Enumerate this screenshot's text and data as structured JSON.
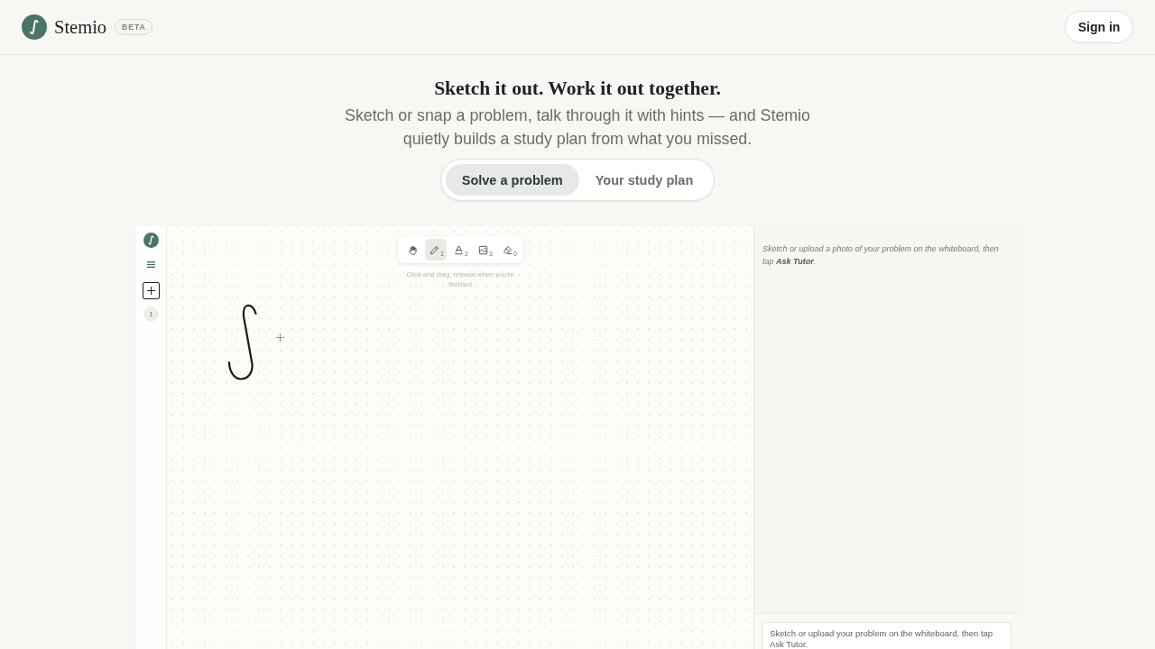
{
  "header": {
    "brand": "Stemio",
    "badge": "BETA",
    "sign_in": "Sign in"
  },
  "hero": {
    "title": "Sketch it out. Work it out together.",
    "subtitle": "Sketch or snap a problem, talk through it with hints — and Stemio quietly builds a study plan from what you missed."
  },
  "mode_tabs": [
    {
      "label": "Solve a problem",
      "selected": true
    },
    {
      "label": "Your study plan",
      "selected": false
    }
  ],
  "workspace": {
    "rail": {
      "page_number": "1"
    },
    "toolbar": {
      "tools": [
        {
          "kind": "hand",
          "selected": false
        },
        {
          "kind": "pencil",
          "selected": true,
          "shortcut": "1"
        },
        {
          "kind": "text",
          "selected": false,
          "shortcut": "2"
        },
        {
          "kind": "image",
          "selected": false,
          "shortcut": "3"
        },
        {
          "kind": "eraser",
          "selected": false,
          "shortcut": "0"
        }
      ]
    },
    "hint": "Click and drag, release when you're finished",
    "tutor_panel": {
      "intro": "Sketch or upload a photo of your problem on the whiteboard, then tap **Ask Tutor**.",
      "composer": {
        "placeholder": "Sketch or upload your problem on the whiteboard, then tap Ask Tutor."
      }
    }
  }
}
